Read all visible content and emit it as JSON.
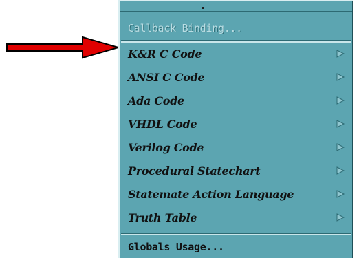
{
  "annotation": {
    "arrow_color": "#e00000",
    "arrow_icon": "red-right-arrow"
  },
  "menu": {
    "background_color": "#5ca5b1",
    "items": [
      {
        "label": "Callback Binding...",
        "enabled": false,
        "has_submenu": false
      },
      {
        "label": "K&R C Code",
        "enabled": true,
        "has_submenu": true
      },
      {
        "label": "ANSI C Code",
        "enabled": true,
        "has_submenu": true
      },
      {
        "label": "Ada Code",
        "enabled": true,
        "has_submenu": true
      },
      {
        "label": "VHDL Code",
        "enabled": true,
        "has_submenu": true
      },
      {
        "label": "Verilog Code",
        "enabled": true,
        "has_submenu": true
      },
      {
        "label": "Procedural Statechart",
        "enabled": true,
        "has_submenu": true
      },
      {
        "label": "Statemate Action Language",
        "enabled": true,
        "has_submenu": true
      },
      {
        "label": "Truth Table",
        "enabled": true,
        "has_submenu": true
      },
      {
        "label": "Globals Usage...",
        "enabled": true,
        "has_submenu": false
      }
    ]
  }
}
